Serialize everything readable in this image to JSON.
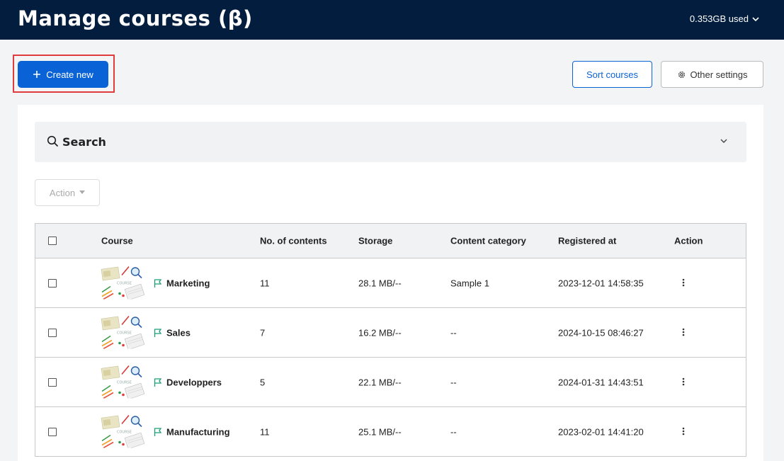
{
  "header": {
    "title": "Manage courses (β)",
    "usage": "0.353GB used"
  },
  "toolbar": {
    "create_label": "Create new",
    "sort_label": "Sort courses",
    "settings_label": "Other settings"
  },
  "search": {
    "label": "Search"
  },
  "bulk_action": {
    "label": "Action"
  },
  "table": {
    "columns": [
      "Course",
      "No. of contents",
      "Storage",
      "Content category",
      "Registered at",
      "Action"
    ],
    "rows": [
      {
        "name": "Marketing",
        "contents": "11",
        "storage": "28.1 MB/--",
        "category": "Sample 1",
        "registered": "2023-12-01 14:58:35"
      },
      {
        "name": "Sales",
        "contents": "7",
        "storage": "16.2 MB/--",
        "category": "--",
        "registered": "2024-10-15 08:46:27"
      },
      {
        "name": "Developpers",
        "contents": "5",
        "storage": "22.1 MB/--",
        "category": "--",
        "registered": "2024-01-31 14:43:51"
      },
      {
        "name": "Manufacturing",
        "contents": "11",
        "storage": "25.1 MB/--",
        "category": "--",
        "registered": "2023-02-01 14:41:20"
      }
    ]
  },
  "colors": {
    "header_bg": "#021d3d",
    "primary": "#0a63d6",
    "highlight": "#e23b3b",
    "flag": "#1a9e78"
  },
  "icons": {
    "create": "plus-icon",
    "settings": "gear-icon",
    "search": "search-icon",
    "expand": "chevron-down-icon",
    "row_flag": "flag-icon",
    "row_menu": "kebab-menu-icon"
  }
}
